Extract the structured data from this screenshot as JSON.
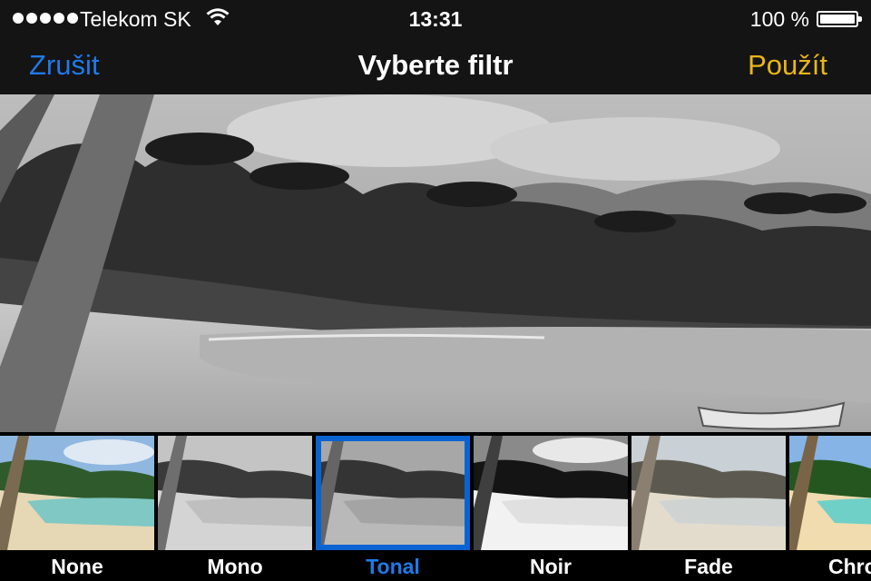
{
  "status": {
    "carrier": "Telekom SK",
    "time": "13:31",
    "battery": "100 %",
    "signal_icon": "signal-dots-icon",
    "wifi_icon": "wifi-icon",
    "battery_icon": "battery-icon"
  },
  "nav": {
    "cancel": "Zrušit",
    "title": "Vyberte filtr",
    "apply": "Použít"
  },
  "colors": {
    "accent_blue": "#1f7ae8",
    "accent_yellow": "#e9b51a",
    "selection": "#0a63d2"
  },
  "filters": [
    {
      "label": "None",
      "selected": false
    },
    {
      "label": "Mono",
      "selected": false
    },
    {
      "label": "Tonal",
      "selected": true
    },
    {
      "label": "Noir",
      "selected": false
    },
    {
      "label": "Fade",
      "selected": false
    },
    {
      "label": "Chro",
      "selected": false
    }
  ]
}
